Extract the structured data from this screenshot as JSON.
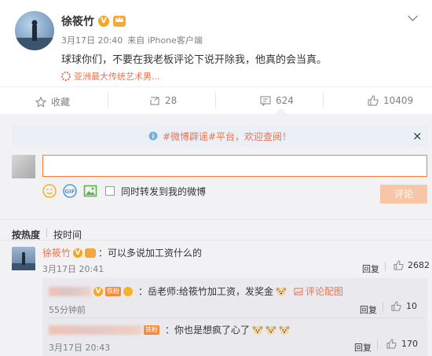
{
  "post": {
    "author": "徐筱竹",
    "v_badge": "V",
    "crown_badge": "",
    "time": "3月17日 20:40",
    "source": "来自 iPhone客户端",
    "content": "球球你们，不要在我老板评论下说开除我，他真的会当真。",
    "topic": "亚洲最大传统艺术男..."
  },
  "actions": {
    "favorite": "收藏",
    "repost": "28",
    "comment": "624",
    "like": "10409"
  },
  "notice": {
    "text": "#微博辟谣#平台，欢迎查阅！",
    "close": "×"
  },
  "composer": {
    "input_value": "",
    "repost_checkbox_label": "同时转发到我的微博",
    "submit_label": "评论"
  },
  "sort": {
    "by_hot": "按热度",
    "by_time": "按时间"
  },
  "comments": [
    {
      "author": "徐筱竹",
      "v_badge": "V",
      "text": "：可以多说加工资什么的",
      "time": "3月17日 20:41",
      "reply_label": "回复",
      "likes": "2682"
    }
  ],
  "replies": [
    {
      "author_hidden": "",
      "badge_text": "铁粉",
      "text": "：岳老师:给筱竹加工资，发奖金",
      "extra_link": "评论配图",
      "time": "55分钟前",
      "reply_label": "回复",
      "likes": "10"
    },
    {
      "author_hidden": "",
      "badge_text": "铁粉",
      "text": "：你也是想疯了心了",
      "time": "3月17日 20:43",
      "reply_label": "回复",
      "likes": "170"
    }
  ],
  "colors": {
    "accent": "#eb7350",
    "submit_bg": "#f7c5a8",
    "input_border": "#fa7d3c",
    "notice_bg": "#eaf0f6"
  }
}
